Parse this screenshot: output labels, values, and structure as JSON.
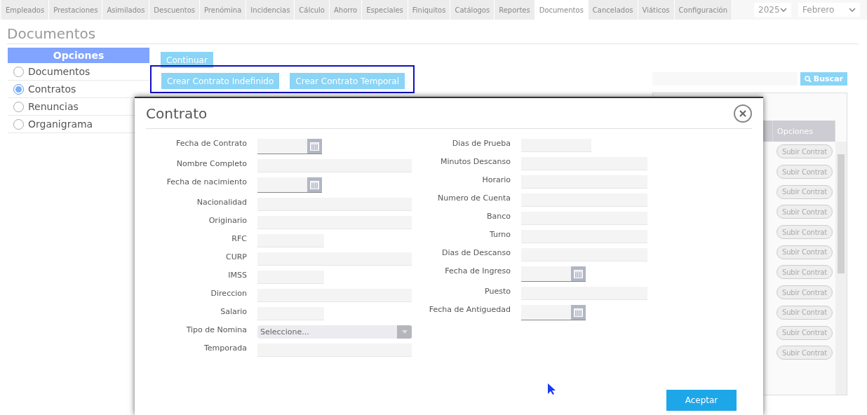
{
  "nav": {
    "tabs": [
      {
        "label": "Empleados",
        "selected": false
      },
      {
        "label": "Prestaciones",
        "selected": false
      },
      {
        "label": "Asimilados",
        "selected": false
      },
      {
        "label": "Descuentos",
        "selected": false
      },
      {
        "label": "Prenómina",
        "selected": false
      },
      {
        "label": "Incidencias",
        "selected": false
      },
      {
        "label": "Cálculo",
        "selected": false
      },
      {
        "label": "Ahorro",
        "selected": false
      },
      {
        "label": "Especiales",
        "selected": false
      },
      {
        "label": "Finiquitos",
        "selected": false
      },
      {
        "label": "Catálogos",
        "selected": false
      },
      {
        "label": "Reportes",
        "selected": false
      },
      {
        "label": "Documentos",
        "selected": true
      },
      {
        "label": "Cancelados",
        "selected": false
      },
      {
        "label": "Viáticos",
        "selected": false
      },
      {
        "label": "Configuración",
        "selected": false
      }
    ],
    "year": "2025",
    "month": "Febrero"
  },
  "page_title": "Documentos",
  "sidebar": {
    "title": "Opciones",
    "items": [
      {
        "label": "Documentos",
        "selected": false
      },
      {
        "label": "Contratos",
        "selected": true
      },
      {
        "label": "Renuncias",
        "selected": false
      },
      {
        "label": "Organigrama",
        "selected": false
      }
    ]
  },
  "actions": {
    "continue": "Continuar",
    "create": [
      "Crear Contrato Indefinido",
      "Crear Contrato Temporal"
    ]
  },
  "search": {
    "button": "Buscar"
  },
  "table": {
    "header": "Opciones",
    "rows": [
      "Subir Contrat",
      "Subir Contrat",
      "Subir Contrat",
      "Subir Contrat",
      "Subir Contrat",
      "Subir Contrat",
      "Subir Contrat",
      "Subir Contrat",
      "Subir Contrat",
      "Subir Contrat",
      "Subir Contrat"
    ]
  },
  "dialog": {
    "title": "Contrato",
    "left_fields": [
      {
        "label": "Fecha de Contrato",
        "kind": "date"
      },
      {
        "label": "Nombre Completo",
        "kind": "text"
      },
      {
        "label": "Fecha de nacimiento",
        "kind": "date"
      },
      {
        "label": "Nacionalidad",
        "kind": "text"
      },
      {
        "label": "Originario",
        "kind": "text"
      },
      {
        "label": "RFC",
        "kind": "short"
      },
      {
        "label": "CURP",
        "kind": "text"
      },
      {
        "label": "IMSS",
        "kind": "short"
      },
      {
        "label": "Direccion",
        "kind": "text"
      },
      {
        "label": "Salario",
        "kind": "short"
      },
      {
        "label": "Tipo de Nomina",
        "kind": "select",
        "value": "Seleccione..."
      },
      {
        "label": "Temporada",
        "kind": "text"
      }
    ],
    "right_fields": [
      {
        "label": "Dias de Prueba",
        "kind": "short"
      },
      {
        "label": "Minutos Descanso",
        "kind": "text"
      },
      {
        "label": "Horario",
        "kind": "text"
      },
      {
        "label": "Numero de Cuenta",
        "kind": "text"
      },
      {
        "label": "Banco",
        "kind": "text"
      },
      {
        "label": "Turno",
        "kind": "text"
      },
      {
        "label": "Dias de Descanso",
        "kind": "text"
      },
      {
        "label": "Fecha de Ingreso",
        "kind": "date"
      },
      {
        "label": "Puesto",
        "kind": "text"
      },
      {
        "label": "Fecha de Antiguedad",
        "kind": "date"
      }
    ],
    "accept": "Aceptar"
  }
}
